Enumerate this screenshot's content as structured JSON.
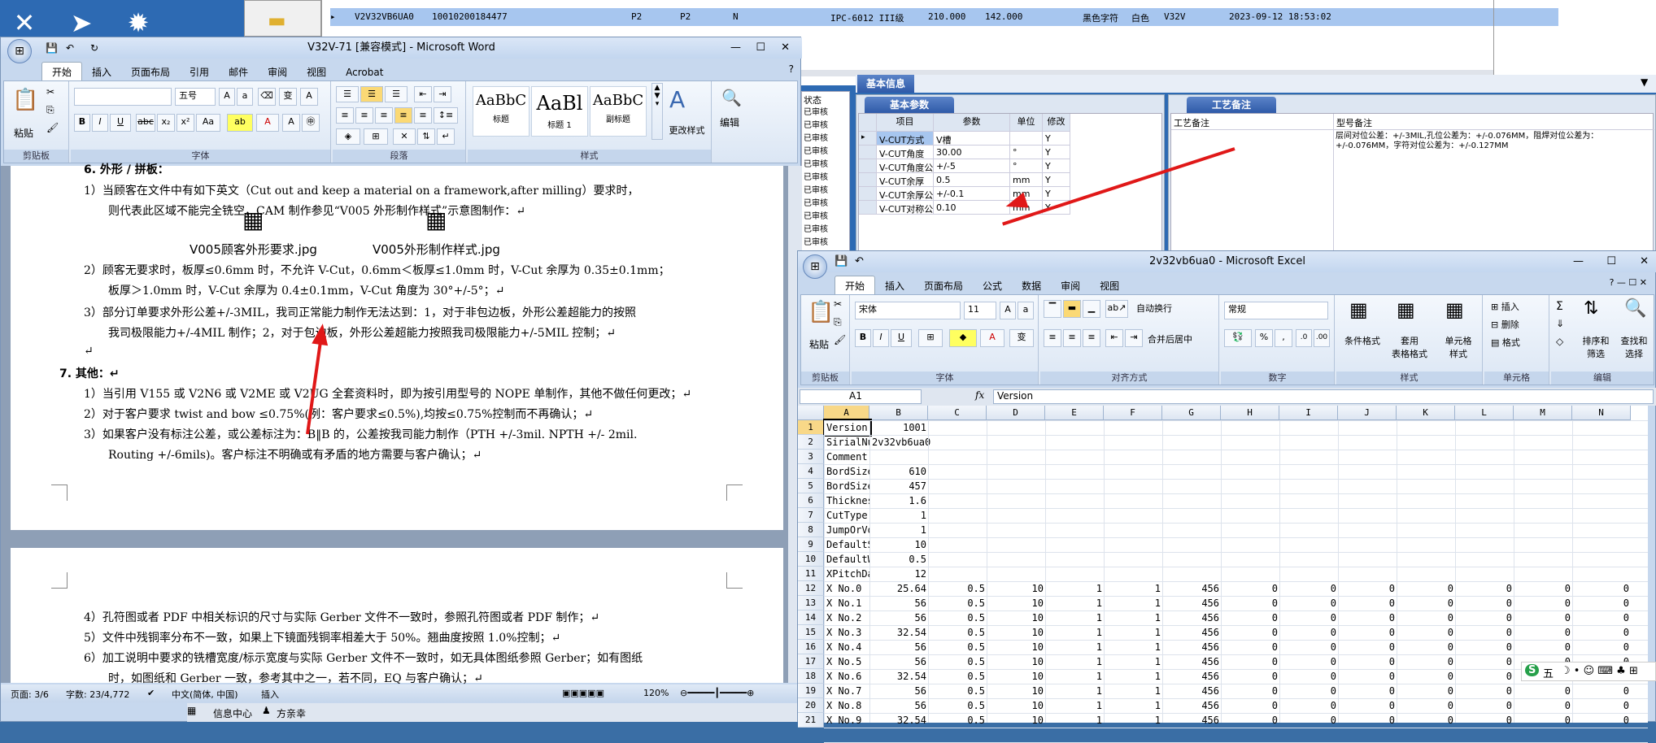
{
  "desktop": {
    "folder_label": "",
    "taskbar": {
      "items": [
        "信息中心",
        "方亲幸"
      ]
    }
  },
  "topgrid": {
    "row": [
      "▸",
      "V2V32VB6UA0",
      "10010200184477",
      "P2",
      "P2",
      "N",
      "IPC-6012 III级",
      "210.000",
      "142.000",
      "黑色字符",
      "白色",
      "V32V",
      "2023-09-12 18:53:02"
    ]
  },
  "info": {
    "header": "基本信息",
    "tab_params": "基本参数",
    "tab_process": "工艺备注",
    "status_header": "状态",
    "status_items": [
      "已审核",
      "已审核",
      "已审核",
      "已审核",
      "已审核",
      "已审核",
      "已审核",
      "已审核",
      "已审核",
      "已审核",
      "已审核"
    ],
    "cols": [
      "项目",
      "参数",
      "单位",
      "修改"
    ],
    "rows": [
      {
        "item": "V-CUT方式",
        "param": "V槽",
        "unit": "",
        "mod": "Y"
      },
      {
        "item": "V-CUT角度",
        "param": "30.00",
        "unit": "°",
        "mod": "Y"
      },
      {
        "item": "V-CUT角度公差",
        "param": "+/-5",
        "unit": "°",
        "mod": "Y"
      },
      {
        "item": "V-CUT余厚",
        "param": "0.5",
        "unit": "mm",
        "mod": "Y"
      },
      {
        "item": "V-CUT余厚公差",
        "param": "+/-0.1",
        "unit": "mm",
        "mod": "Y"
      },
      {
        "item": "V-CUT对称公差",
        "param": "0.10",
        "unit": "mm",
        "mod": "Y"
      }
    ],
    "process_col": "工艺备注",
    "model_col": "型号备注",
    "model_note": "层间对位公差：+/-3MIL,孔位公差为：+/-0.076MM，阻焊对位公差为：+/-0.076MM，字符对位公差为：+/-0.127MM"
  },
  "word": {
    "title": "V32V-71 [兼容模式] - Microsoft Word",
    "tabs": [
      "开始",
      "插入",
      "页面布局",
      "引用",
      "邮件",
      "审阅",
      "视图",
      "Acrobat"
    ],
    "font_name": "",
    "font_size": "五号",
    "groups": [
      "剪贴板",
      "字体",
      "段落",
      "样式",
      "编辑"
    ],
    "paste": "粘贴",
    "styles": [
      {
        "preview": "AaBbC",
        "name": "标题"
      },
      {
        "preview": "AaBl",
        "name": "标题 1"
      },
      {
        "preview": "AaBbC",
        "name": "副标题"
      }
    ],
    "change_style": "更改样式",
    "edit": "编辑",
    "lines": [
      "6.  外形 / 拼板：",
      "1）当顾客在文件中有如下英文（Cut out and keep a material on a framework,after milling）要求时，",
      "则代表此区域不能完全铣空，CAM 制作参见“V005 外形制作样式”示意图制作：↵",
      "2）顾客无要求时，板厚≤0.6mm 时，不允许 V-Cut，0.6mm＜板厚≤1.0mm 时，V-Cut 余厚为 0.35±0.1mm；",
      "板厚＞1.0mm 时，V-Cut 余厚为 0.4±0.1mm，V-Cut 角度为 30°+/-5°；↵",
      "3）部分订单要求外形公差+/-3MIL，我司正常能力制作无法达到：1，对于非包边板，外形公差超能力的按照",
      "我司极限能力+/-4MIL 制作；2，对于包边板，外形公差超能力按照我司极限能力+/-5MIL 控制；↵",
      "↵",
      "7.  其他：↵",
      "1）当引用 V155 或 V2N6 或 V2ME 或 V2UG 全套资料时，即为按引用型号的 NOPE 单制作，其他不做任何更改；↵",
      "2）对于客户要求 twist and bow ≤0.75%(例：客户要求≤0.5%),均按≤0.75%控制而不再确认；↵",
      "3）如果客户没有标注公差，或公差标注为：B‖B 的，公差按我司能力制作（PTH +/-3mil. NPTH +/- 2mil.",
      "Routing +/-6mils)。客户标注不明确或有矛盾的地方需要与客户确认；↵",
      "4）孔符图或者 PDF 中相关标识的尺寸与实际 Gerber 文件不一致时，参照孔符图或者 PDF 制作；↵",
      "5）文件中残铜率分布不一致，如果上下镜面残铜率相差大于 50%。翘曲度按照 1.0%控制；↵",
      "6）加工说明中要求的铣槽宽度/标示宽度与实际 Gerber 文件不一致时，如无具体图纸参照 Gerber；如有图纸",
      "时，如图纸和 Gerber 一致，参考其中之一，若不同，EQ 与客户确认；↵"
    ],
    "attach1": "V005顾客外形要求.jpg",
    "attach2": "V005外形制作样式.jpg",
    "status": {
      "page": "页面: 3/6",
      "words": "字数: 23/4,772",
      "lang": "中文(简体, 中国)",
      "mode": "插入",
      "zoom": "120%"
    }
  },
  "excel": {
    "title": "2v32vb6ua0 - Microsoft Excel",
    "tabs": [
      "开始",
      "插入",
      "页面布局",
      "公式",
      "数据",
      "审阅",
      "视图"
    ],
    "font_name": "宋体",
    "font_size": "11",
    "wrap": "自动换行",
    "merge": "合并后居中",
    "numfmt": "常规",
    "groups": [
      "剪贴板",
      "字体",
      "对齐方式",
      "数字",
      "样式",
      "单元格",
      "编辑"
    ],
    "paste": "粘贴",
    "cond": "条件格式",
    "table": "套用\n表格格式",
    "cellstyle": "单元格\n样式",
    "insert": "插入",
    "delete": "删除",
    "format": "格式",
    "sort": "排序和\n筛选",
    "find": "查找和\n选择",
    "cellref": "A1",
    "fx": "fx",
    "formula": "Version",
    "cols": [
      "A",
      "B",
      "C",
      "D",
      "E",
      "F",
      "G",
      "H",
      "I",
      "J",
      "K",
      "L",
      "M",
      "N"
    ],
    "rows": [
      [
        "1",
        "Version",
        "1001"
      ],
      [
        "2",
        "SirialNum",
        "2v32vb6ua0"
      ],
      [
        "3",
        "Comment",
        ""
      ],
      [
        "4",
        "BordSizeX",
        "610"
      ],
      [
        "5",
        "BordSizeY",
        "457"
      ],
      [
        "6",
        "Thickness",
        "1.6"
      ],
      [
        "7",
        "CutType",
        "1"
      ],
      [
        "8",
        "JumpOrVor",
        "1"
      ],
      [
        "9",
        "DefaultSp",
        "10"
      ],
      [
        "10",
        "DefaultWe",
        "0.5"
      ],
      [
        "11",
        "XPitchDat",
        "12"
      ],
      [
        "12",
        "X No.0",
        "25.64",
        "0.5",
        "10",
        "1",
        "1",
        "456",
        "0",
        "0",
        "0",
        "0",
        "0",
        "0",
        "0"
      ],
      [
        "13",
        "X No.1",
        "56",
        "0.5",
        "10",
        "1",
        "1",
        "456",
        "0",
        "0",
        "0",
        "0",
        "0",
        "0",
        "0"
      ],
      [
        "14",
        "X No.2",
        "56",
        "0.5",
        "10",
        "1",
        "1",
        "456",
        "0",
        "0",
        "0",
        "0",
        "0",
        "0",
        "0"
      ],
      [
        "15",
        "X No.3",
        "32.54",
        "0.5",
        "10",
        "1",
        "1",
        "456",
        "0",
        "0",
        "0",
        "0",
        "0",
        "0",
        "0"
      ],
      [
        "16",
        "X No.4",
        "56",
        "0.5",
        "10",
        "1",
        "1",
        "456",
        "0",
        "0",
        "0",
        "0",
        "0",
        "0",
        "0"
      ],
      [
        "17",
        "X No.5",
        "56",
        "0.5",
        "10",
        "1",
        "1",
        "456",
        "0",
        "0",
        "0",
        "0",
        "0",
        "0",
        "0"
      ],
      [
        "18",
        "X No.6",
        "32.54",
        "0.5",
        "10",
        "1",
        "1",
        "456",
        "0",
        "0",
        "0",
        "0",
        "0",
        "0",
        "0"
      ],
      [
        "19",
        "X No.7",
        "56",
        "0.5",
        "10",
        "1",
        "1",
        "456",
        "0",
        "0",
        "0",
        "0",
        "0",
        "0",
        "0"
      ],
      [
        "20",
        "X No.8",
        "56",
        "0.5",
        "10",
        "1",
        "1",
        "456",
        "0",
        "0",
        "0",
        "0",
        "0",
        "0",
        "0"
      ],
      [
        "21",
        "X No.9",
        "32.54",
        "0.5",
        "10",
        "1",
        "1",
        "456",
        "0",
        "0",
        "0",
        "0",
        "0",
        "0",
        "0"
      ]
    ]
  },
  "tray": {
    "ime": "五"
  }
}
